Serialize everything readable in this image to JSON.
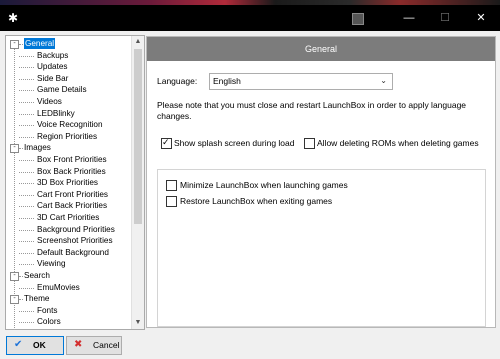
{
  "window": {
    "gear_glyph": "✱",
    "minimize_glyph": "—",
    "maximize_glyph": "☐",
    "close_glyph": "✕"
  },
  "tree": {
    "items": [
      {
        "label": "General",
        "level": 0,
        "expander": "-",
        "selected": true
      },
      {
        "label": "Backups",
        "level": 1
      },
      {
        "label": "Updates",
        "level": 1
      },
      {
        "label": "Side Bar",
        "level": 1
      },
      {
        "label": "Game Details",
        "level": 1
      },
      {
        "label": "Videos",
        "level": 1
      },
      {
        "label": "LEDBlinky",
        "level": 1
      },
      {
        "label": "Voice Recognition",
        "level": 1
      },
      {
        "label": "Region Priorities",
        "level": 1
      },
      {
        "label": "Images",
        "level": 0,
        "expander": "-"
      },
      {
        "label": "Box Front Priorities",
        "level": 1
      },
      {
        "label": "Box Back Priorities",
        "level": 1
      },
      {
        "label": "3D Box Priorities",
        "level": 1
      },
      {
        "label": "Cart Front Priorities",
        "level": 1
      },
      {
        "label": "Cart Back Priorities",
        "level": 1
      },
      {
        "label": "3D Cart Priorities",
        "level": 1
      },
      {
        "label": "Background Priorities",
        "level": 1
      },
      {
        "label": "Screenshot Priorities",
        "level": 1
      },
      {
        "label": "Default Background",
        "level": 1
      },
      {
        "label": "Viewing",
        "level": 1
      },
      {
        "label": "Search",
        "level": 0,
        "expander": "-"
      },
      {
        "label": "EmuMovies",
        "level": 1
      },
      {
        "label": "Theme",
        "level": 0,
        "expander": "-"
      },
      {
        "label": "Fonts",
        "level": 1
      },
      {
        "label": "Colors",
        "level": 1
      }
    ]
  },
  "panel": {
    "title": "General",
    "language_label": "Language:",
    "language_value": "English",
    "note": "Please note that you must close and restart LaunchBox in order to apply language changes.",
    "checkboxes": {
      "splash": {
        "label": "Show splash screen during load",
        "checked": true
      },
      "allow_delete": {
        "label": "Allow deleting ROMs when deleting games",
        "checked": false
      },
      "minimize": {
        "label": "Minimize LaunchBox when launching games",
        "checked": false
      },
      "restore": {
        "label": "Restore LaunchBox when exiting games",
        "checked": false
      }
    }
  },
  "buttons": {
    "ok": {
      "label": "OK",
      "icon": "check-icon",
      "glyph": "✔",
      "color": "#1e73d8"
    },
    "cancel": {
      "label": "Cancel",
      "icon": "cancel-icon",
      "glyph": "✖",
      "color": "#d32f2f"
    }
  },
  "colors": {
    "selection": "#0078d7",
    "panel_header": "#7c7c7c",
    "titlebar": "#000000"
  }
}
